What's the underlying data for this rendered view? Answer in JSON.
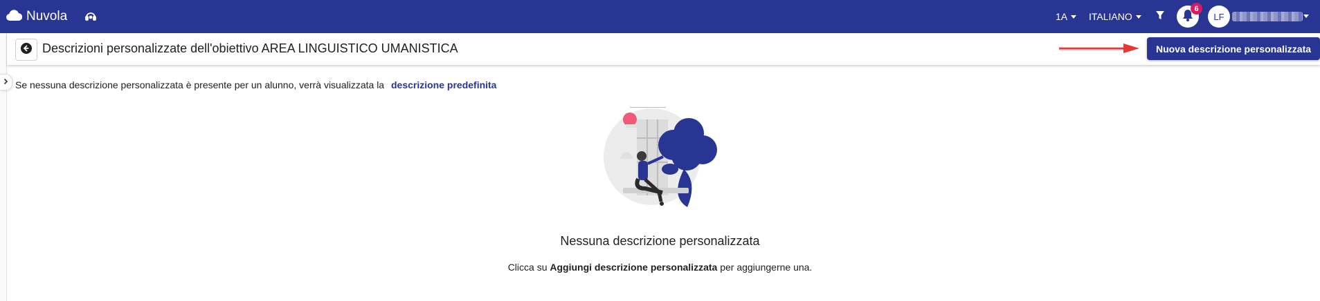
{
  "topbar": {
    "brand": "Nuvola",
    "class_selector": "1A",
    "subject_selector": "ITALIANO",
    "notification_count": "6",
    "user_initials": "LF"
  },
  "header": {
    "title": "Descrizioni personalizzate dell'obiettivo AREA LINGUISTICO UMANISTICA",
    "new_button": "Nuova descrizione personalizzata"
  },
  "info": {
    "text": "Se nessuna descrizione personalizzata è presente per un alunno, verrà visualizzata la",
    "link": "descrizione predefinita"
  },
  "empty_state": {
    "title": "Nessuna descrizione personalizzata",
    "sub_prefix": "Clicca su",
    "sub_bold": "Aggiungi descrizione personalizzata",
    "sub_suffix": "per aggiungerne una."
  },
  "colors": {
    "primary": "#283593",
    "badge": "#d81b60",
    "annotation_arrow": "#e53935"
  },
  "icons": [
    "cloud-icon",
    "support-icon",
    "filter-icon",
    "bell-icon",
    "back-arrow-icon",
    "chevron-right-icon"
  ]
}
